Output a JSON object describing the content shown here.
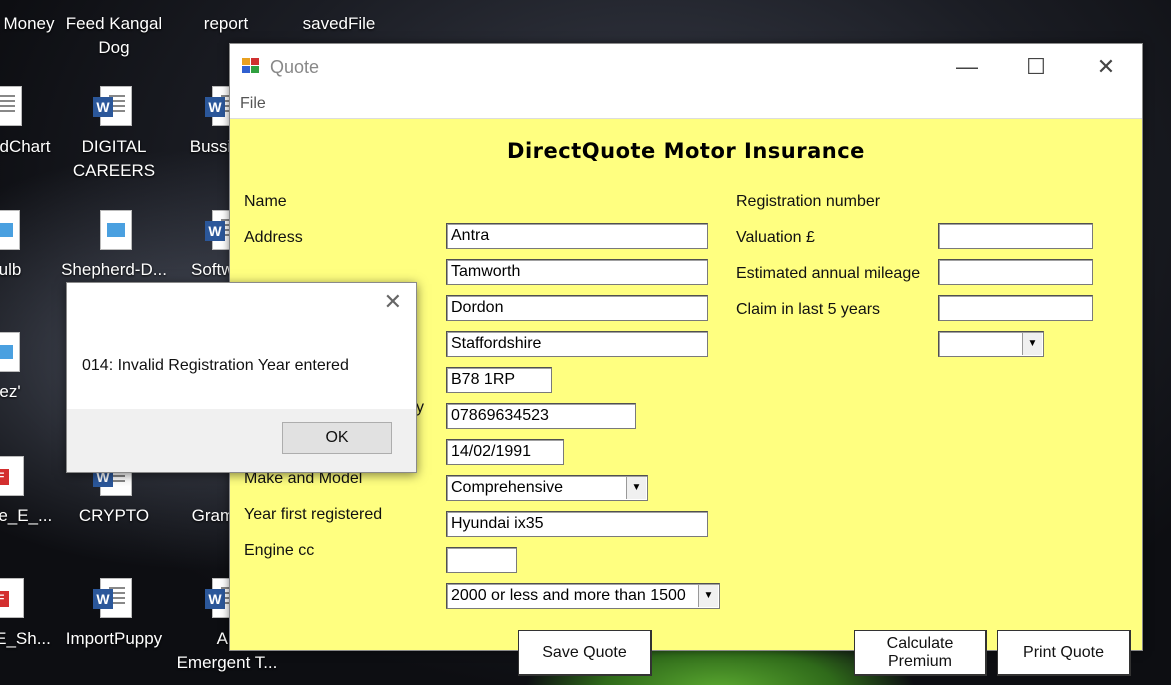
{
  "desktop": {
    "icons": [
      {
        "label1": "Money",
        "label2": ""
      },
      {
        "label1": "Feed Kangal",
        "label2": "Dog"
      },
      {
        "label1": "report",
        "label2": ""
      },
      {
        "label1": "savedFile",
        "label2": ""
      },
      {
        "label1": "dChart",
        "label2": ""
      },
      {
        "label1": "DIGITAL",
        "label2": "CAREERS"
      },
      {
        "label1": "Bussine",
        "label2": ""
      },
      {
        "label1": "ulb",
        "label2": ""
      },
      {
        "label1": "Shepherd-D...",
        "label2": ""
      },
      {
        "label1": "Softwa",
        "label2": ""
      },
      {
        "label1": "ez'",
        "label2": ""
      },
      {
        "label1": "ce_E_...",
        "label2": ""
      },
      {
        "label1": "CRYPTO",
        "label2": ""
      },
      {
        "label1": "Gramm",
        "label2": ""
      },
      {
        "label1": "E_Sh...",
        "label2": ""
      },
      {
        "label1": "ImportPuppy",
        "label2": ""
      },
      {
        "label1": "An",
        "label2": "Emergent T..."
      }
    ]
  },
  "window": {
    "title": "Quote",
    "minimize": "—",
    "maximize": "☐",
    "close": "✕",
    "menu": {
      "file": "File"
    }
  },
  "form": {
    "heading": "DirectQuote Motor Insurance",
    "labels": {
      "name": "Name",
      "address": "Address",
      "dob_partial": "y",
      "make_model": "Make and Model",
      "year_registered": "Year first registered",
      "engine_cc": "Engine cc",
      "registration_number": "Registration number",
      "valuation": "Valuation £",
      "mileage": "Estimated annual mileage",
      "claim": "Claim in last 5 years"
    },
    "values": {
      "name": "Antra",
      "address1": "Tamworth",
      "address2": "Dordon",
      "address3": "Staffordshire",
      "postcode": "B78 1RP",
      "phone": "07869634523",
      "dob": "14/02/1991",
      "cover_type": "Comprehensive",
      "make_model": "Hyundai ix35",
      "year_registered": "",
      "engine_cc": "2000 or less and more than 1500",
      "registration_number": "",
      "valuation": "",
      "mileage": "",
      "claim": ""
    },
    "buttons": {
      "save": "Save Quote",
      "calculate_line1": "Calculate",
      "calculate_line2": "Premium",
      "print": "Print Quote"
    }
  },
  "dialog": {
    "message": "014: Invalid Registration Year entered",
    "ok": "OK",
    "close": "✕"
  },
  "colors": {
    "form_background": "#ffff80",
    "word_blue": "#2b579a",
    "pdf_red": "#d32f2f"
  }
}
